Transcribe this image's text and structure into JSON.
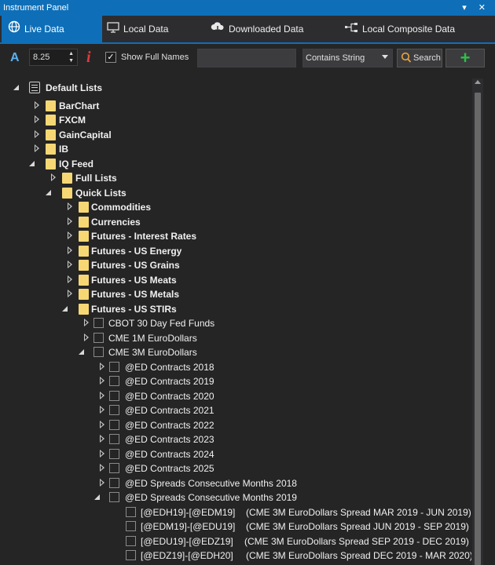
{
  "window": {
    "title": "Instrument Panel",
    "controls": "▾ ✕"
  },
  "tabs": [
    {
      "label": "Live Data",
      "icon": "globe-icon"
    },
    {
      "label": "Local Data",
      "icon": "monitor-icon"
    },
    {
      "label": "Downloaded Data",
      "icon": "cloud-download-icon"
    },
    {
      "label": "Local Composite Data",
      "icon": "composite-icon"
    }
  ],
  "toolbar": {
    "font_icon": "A",
    "font_size": "8.25",
    "info_icon": "i",
    "show_full_names_label": "Show Full Names",
    "show_full_names_checked": "✓",
    "search_value": "",
    "filter_value": "Contains String",
    "search_label": "Search",
    "add_label": "+"
  },
  "tree": {
    "root": "Default Lists",
    "barchart": "BarChart",
    "fxcm": "FXCM",
    "gaincapital": "GainCapital",
    "ib": "IB",
    "iqfeed": "IQ Feed",
    "fulllists": "Full Lists",
    "quicklists": "Quick Lists",
    "commodities": "Commodities",
    "currencies": "Currencies",
    "fut_interest": "Futures - Interest Rates",
    "fut_energy": "Futures - US Energy",
    "fut_grains": "Futures - US Grains",
    "fut_meats": "Futures - US Meats",
    "fut_metals": "Futures - US Metals",
    "fut_stirs": "Futures - US STIRs",
    "cbot30": "CBOT 30 Day Fed Funds",
    "cme1m": "CME 1M EuroDollars",
    "cme3m": "CME 3M EuroDollars",
    "ed2018": "@ED Contracts 2018",
    "ed2019": "@ED Contracts 2019",
    "ed2020": "@ED Contracts 2020",
    "ed2021": "@ED Contracts 2021",
    "ed2022": "@ED Contracts 2022",
    "ed2023": "@ED Contracts 2023",
    "ed2024": "@ED Contracts 2024",
    "ed2025": "@ED Contracts 2025",
    "spr2018": "@ED  Spreads Consecutive Months 2018",
    "spr2019": "@ED  Spreads Consecutive Months 2019",
    "leaves": [
      {
        "symbol": "[@EDH19]-[@EDM19]",
        "desc": "(CME 3M EuroDollars Spread MAR 2019 - JUN 2019)"
      },
      {
        "symbol": "[@EDM19]-[@EDU19]",
        "desc": "(CME 3M EuroDollars Spread JUN 2019 - SEP 2019)"
      },
      {
        "symbol": "[@EDU19]-[@EDZ19]",
        "desc": "(CME 3M EuroDollars Spread SEP 2019 - DEC 2019)"
      },
      {
        "symbol": "[@EDZ19]-[@EDH20]",
        "desc": "(CME 3M EuroDollars Spread DEC 2019 - MAR 2020)"
      }
    ]
  }
}
